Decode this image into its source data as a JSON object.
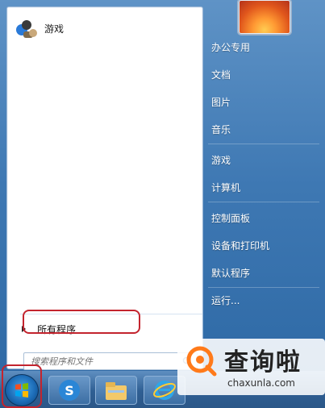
{
  "left_panel": {
    "pinned": [
      {
        "label": "游戏",
        "icon": "games-icon"
      }
    ],
    "all_programs_label": "所有程序",
    "search": {
      "placeholder": "搜索程序和文件",
      "icon": "search-icon"
    }
  },
  "right_panel": {
    "user_tile": "user-picture-icon",
    "items": [
      {
        "label": "办公专用"
      },
      {
        "label": "文档"
      },
      {
        "label": "图片"
      },
      {
        "label": "音乐"
      },
      {
        "label": "游戏"
      },
      {
        "label": "计算机"
      },
      {
        "label": "控制面板"
      },
      {
        "label": "设备和打印机"
      },
      {
        "label": "默认程序"
      },
      {
        "label": "运行..."
      }
    ]
  },
  "taskbar": {
    "start_icon": "windows-start-icon",
    "apps": [
      "sogou-input-icon",
      "file-explorer-icon",
      "internet-explorer-icon"
    ]
  },
  "watermark": {
    "title": "查询啦",
    "url": "chaxunla.com"
  },
  "colors": {
    "highlight_red": "#c3242e",
    "accent_blue": "#2f6aa6"
  }
}
